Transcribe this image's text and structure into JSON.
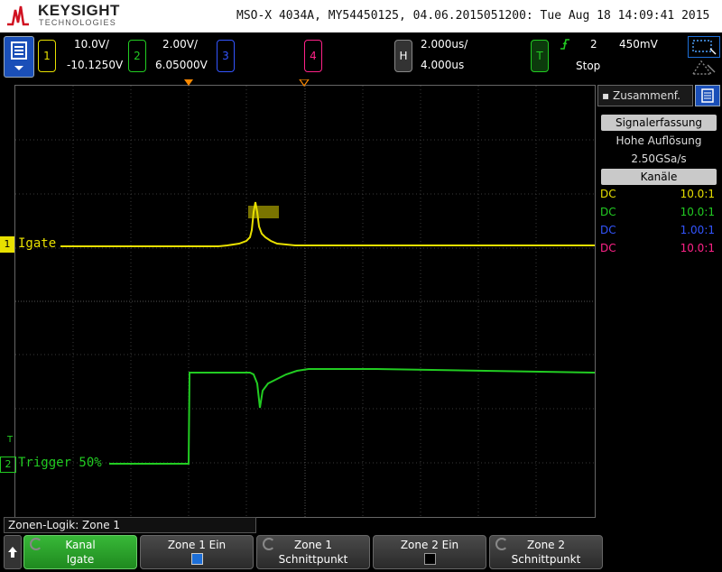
{
  "header": {
    "brand": "KEYSIGHT",
    "brand_sub": "TECHNOLOGIES",
    "instrument_info": "MSO-X 4034A, MY54450125, 04.06.2015051200: Tue Aug 18 14:09:41 2015"
  },
  "channels": [
    {
      "num": "1",
      "scale": "10.0V/",
      "offset": "-10.1250V",
      "color": "#e8e000"
    },
    {
      "num": "2",
      "scale": "2.00V/",
      "offset": "6.05000V",
      "color": "#22cc22"
    },
    {
      "num": "3",
      "color": "#3355ff"
    },
    {
      "num": "4",
      "color": "#ff2288"
    }
  ],
  "horizontal": {
    "label": "H",
    "scale": "2.000us/",
    "delay": "4.000us"
  },
  "trigger": {
    "label": "T",
    "source": "2",
    "level": "450mV",
    "mode": "Stop"
  },
  "waveform_labels": {
    "ch1": "Igate",
    "ch2": "Trigger 50%",
    "ch1_marker": "1",
    "ch2_marker": "2"
  },
  "side_panel": {
    "tab_label": "Zusammenf.",
    "acq_button": "Signalerfassung",
    "acq_mode": "Hohe Auflösung",
    "sample_rate": "2.50GSa/s",
    "channels_button": "Kanäle",
    "rows": [
      {
        "coupling": "DC",
        "probe": "10.0:1",
        "color": "#e8e000"
      },
      {
        "coupling": "DC",
        "probe": "10.0:1",
        "color": "#22cc22"
      },
      {
        "coupling": "DC",
        "probe": "1.00:1",
        "color": "#3355ff"
      },
      {
        "coupling": "DC",
        "probe": "10.0:1",
        "color": "#ff2288"
      }
    ]
  },
  "zone_logic": "Zonen-Logik: Zone 1",
  "softkeys": [
    {
      "l1": "Kanal",
      "l2": "Igate"
    },
    {
      "l1": "Zone 1 Ein"
    },
    {
      "l1": "Zone 1",
      "l2": "Schnittpunkt"
    },
    {
      "l1": "Zone 2 Ein"
    },
    {
      "l1": "Zone 2",
      "l2": "Schnittpunkt"
    }
  ],
  "colors": {
    "ch1": "#e8e000",
    "ch2": "#22cc22",
    "zone_box": "#7a7400",
    "softkey_active": "#2a9a2a"
  }
}
